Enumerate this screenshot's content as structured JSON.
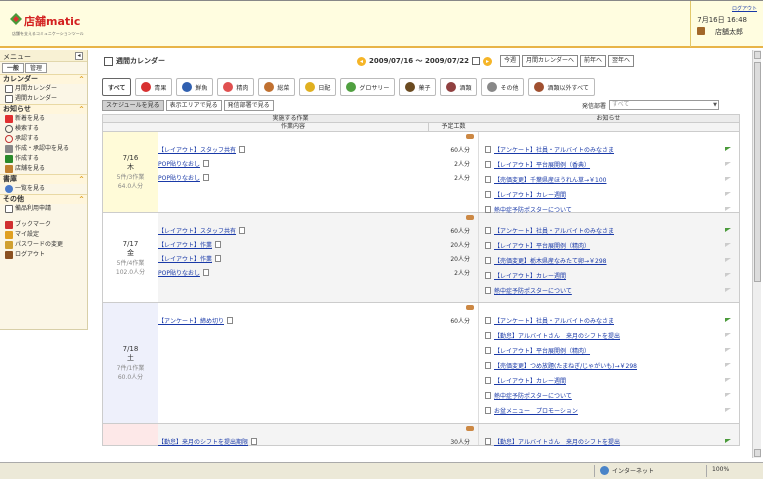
{
  "header": {
    "logo_text": "店舗matic",
    "logo_sub": "店舗を支えるコミュニケーションツール",
    "logout": "ログアウト",
    "date": "7月16日 16:48",
    "user": "店舗太郎"
  },
  "sidebar": {
    "title": "メニュー",
    "tabs": [
      "一般",
      "管理"
    ],
    "sections": [
      {
        "label": "カレンダー",
        "items": [
          "月間カレンダー",
          "週間カレンダー"
        ]
      },
      {
        "label": "お知らせ",
        "items": [
          "新着を見る",
          "検索する",
          "承認する",
          "作成・承認中を見る",
          "作成する",
          "店舗を見る"
        ]
      },
      {
        "label": "書庫",
        "items": [
          "一覧を見る"
        ]
      },
      {
        "label": "その他",
        "items": [
          "備品利用申請"
        ]
      }
    ],
    "extra": [
      "ブックマーク",
      "マイ設定",
      "パスワードの変更",
      "ログアウト"
    ]
  },
  "main": {
    "title": "週間カレンダー",
    "range": "2009/07/16 〜 2009/07/22",
    "buttons": [
      "今週",
      "月間カレンダーへ",
      "前年へ",
      "翌年へ"
    ],
    "categories": [
      {
        "label": "すべて",
        "color": "#ffffff"
      },
      {
        "label": "青果",
        "color": "#d83030"
      },
      {
        "label": "鮮魚",
        "color": "#3060b0"
      },
      {
        "label": "精肉",
        "color": "#e05050"
      },
      {
        "label": "総菜",
        "color": "#c07030"
      },
      {
        "label": "日配",
        "color": "#e0b020"
      },
      {
        "label": "グロサリー",
        "color": "#50a040"
      },
      {
        "label": "菓子",
        "color": "#6a4a20"
      },
      {
        "label": "酒類",
        "color": "#904040"
      },
      {
        "label": "その他",
        "color": "#888888"
      },
      {
        "label": "酒類以外すべて",
        "color": "#a05030"
      }
    ],
    "subtabs": [
      "スケジュールを見る",
      "表示エリアで見る",
      "発信部署で見る"
    ],
    "dept_label": "発信部署",
    "dept_value": "すべて",
    "th_work": "実施する作業",
    "th_notice": "お知らせ",
    "th_content": "作業内容",
    "th_min": "予定工数"
  },
  "days": [
    {
      "date": "7/16",
      "weekday": "木",
      "sub1": "5件/3作業",
      "sub2": "64.0人分",
      "tasks": [
        {
          "label": "【レイアウト】スタッフ共有",
          "min": "60人分"
        },
        {
          "label": "POP貼りなおし",
          "min": "2人分"
        },
        {
          "label": "POP貼りなおし",
          "min": "2人分"
        }
      ],
      "notices": [
        "【アンケート】社員・アルバイトのみなさま",
        "【レイアウト】平台展開例（香典）",
        "【売価変更】千葉県産ほうれん草→￥100",
        "【レイアウト】カレー週間",
        "熱中症予防ポスターについて"
      ]
    },
    {
      "date": "7/17",
      "weekday": "金",
      "sub1": "5件/4作業",
      "sub2": "102.0人分",
      "tasks": [
        {
          "label": "【レイアウト】スタッフ共有",
          "min": "60人分"
        },
        {
          "label": "【レイアウト】作業",
          "min": "20人分"
        },
        {
          "label": "【レイアウト】作業",
          "min": "20人分"
        },
        {
          "label": "POP貼りなおし",
          "min": "2人分"
        }
      ],
      "notices": [
        "【アンケート】社員・アルバイトのみなさま",
        "【レイアウト】平台展開例（精肉）",
        "【売価変更】栃木県産なみたて卵→￥298",
        "【レイアウト】カレー週間",
        "熱中症予防ポスターについて"
      ]
    },
    {
      "date": "7/18",
      "weekday": "土",
      "sub1": "7件/1作業",
      "sub2": "60.0人分",
      "tasks": [
        {
          "label": "【アンケート】締め切り",
          "min": "60人分"
        }
      ],
      "notices": [
        "【アンケート】社員・アルバイトのみなさま",
        "【勤怠】アルバイトさん　来月のシフトを提出",
        "【レイアウト】平台展開例（精肉）",
        "【売価変更】つめ放題(たまねぎ/じゃがいも)→￥298",
        "【レイアウト】カレー週間",
        "熱中症予防ポスターについて",
        "お盆メニュー　プロモーション"
      ]
    },
    {
      "date": "",
      "weekday": "",
      "sub1": "",
      "sub2": "",
      "tasks": [
        {
          "label": "【勤怠】来月のシフトを提出期限",
          "min": "30人分"
        }
      ],
      "notices": [
        "【勤怠】アルバイトさん　来月のシフトを提出"
      ]
    }
  ],
  "statusbar": {
    "zone": "インターネット",
    "zoom": "100%"
  }
}
